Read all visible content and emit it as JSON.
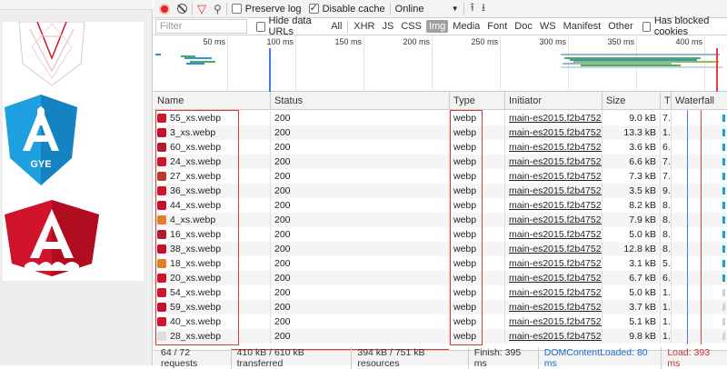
{
  "toolbar": {
    "record_icon": "record-icon",
    "clear_icon": "clear-icon",
    "filter_icon": "filter-icon",
    "search_icon": "search-icon",
    "preserve_log_label": "Preserve log",
    "preserve_log_checked": false,
    "disable_cache_label": "Disable cache",
    "disable_cache_checked": true,
    "throttle_value": "Online",
    "import_icon": "upload-icon",
    "export_icon": "download-icon"
  },
  "filterbar": {
    "placeholder": "Filter",
    "hide_data_urls_label": "Hide data URLs",
    "types": [
      "All",
      "XHR",
      "JS",
      "CSS",
      "Img",
      "Media",
      "Font",
      "Doc",
      "WS",
      "Manifest",
      "Other"
    ],
    "active_type": "Img",
    "blocked_cookies_label": "Has blocked cookies"
  },
  "overview": {
    "ticks": [
      "50 ms",
      "100 ms",
      "150 ms",
      "200 ms",
      "250 ms",
      "300 ms",
      "350 ms",
      "400 ms"
    ]
  },
  "table": {
    "headers": {
      "name": "Name",
      "status": "Status",
      "type": "Type",
      "initiator": "Initiator",
      "size": "Size",
      "time": "T",
      "waterfall": "Waterfall"
    },
    "rows": [
      {
        "name": "55_xs.webp",
        "status": "200",
        "type": "webp",
        "initiator": "main-es2015.f2b4752...",
        "size": "9.0 kB",
        "time": "7."
      },
      {
        "name": "3_xs.webp",
        "status": "200",
        "type": "webp",
        "initiator": "main-es2015.f2b4752...",
        "size": "13.3 kB",
        "time": "1."
      },
      {
        "name": "60_xs.webp",
        "status": "200",
        "type": "webp",
        "initiator": "main-es2015.f2b4752...",
        "size": "3.6 kB",
        "time": "6."
      },
      {
        "name": "24_xs.webp",
        "status": "200",
        "type": "webp",
        "initiator": "main-es2015.f2b4752...",
        "size": "6.6 kB",
        "time": "7."
      },
      {
        "name": "27_xs.webp",
        "status": "200",
        "type": "webp",
        "initiator": "main-es2015.f2b4752...",
        "size": "7.3 kB",
        "time": "7."
      },
      {
        "name": "36_xs.webp",
        "status": "200",
        "type": "webp",
        "initiator": "main-es2015.f2b4752...",
        "size": "3.5 kB",
        "time": "9."
      },
      {
        "name": "44_xs.webp",
        "status": "200",
        "type": "webp",
        "initiator": "main-es2015.f2b4752...",
        "size": "8.2 kB",
        "time": "8."
      },
      {
        "name": "4_xs.webp",
        "status": "200",
        "type": "webp",
        "initiator": "main-es2015.f2b4752...",
        "size": "7.9 kB",
        "time": "8."
      },
      {
        "name": "16_xs.webp",
        "status": "200",
        "type": "webp",
        "initiator": "main-es2015.f2b4752...",
        "size": "5.0 kB",
        "time": "8."
      },
      {
        "name": "38_xs.webp",
        "status": "200",
        "type": "webp",
        "initiator": "main-es2015.f2b4752...",
        "size": "12.8 kB",
        "time": "8."
      },
      {
        "name": "18_xs.webp",
        "status": "200",
        "type": "webp",
        "initiator": "main-es2015.f2b4752...",
        "size": "3.1 kB",
        "time": "5."
      },
      {
        "name": "20_xs.webp",
        "status": "200",
        "type": "webp",
        "initiator": "main-es2015.f2b4752...",
        "size": "6.7 kB",
        "time": "6."
      },
      {
        "name": "54_xs.webp",
        "status": "200",
        "type": "webp",
        "initiator": "main-es2015.f2b4752...",
        "size": "5.0 kB",
        "time": "1."
      },
      {
        "name": "59_xs.webp",
        "status": "200",
        "type": "webp",
        "initiator": "main-es2015.f2b4752...",
        "size": "3.7 kB",
        "time": "1."
      },
      {
        "name": "40_xs.webp",
        "status": "200",
        "type": "webp",
        "initiator": "main-es2015.f2b4752...",
        "size": "5.1 kB",
        "time": "1."
      },
      {
        "name": "28_xs.webp",
        "status": "200",
        "type": "webp",
        "initiator": "main-es2015.f2b4752...",
        "size": "9.8 kB",
        "time": "1."
      }
    ]
  },
  "statusbar": {
    "requests": "64 / 72 requests",
    "transferred": "410 kB / 610 kB transferred",
    "resources": "394 kB / 751 kB resources",
    "finish": "Finish: 395 ms",
    "dom_content_loaded": "DOMContentLoaded: 80 ms",
    "load": "Load: 393 ms"
  },
  "preview": {
    "logo_text": "GYE"
  },
  "colors": {
    "angular_red": "#d0142b",
    "angular_blue": "#1e9fe0",
    "highlight_red": "#d83a3a",
    "record_red": "#e52521",
    "dcl_blue": "#1a6fd6",
    "load_red": "#c33333"
  }
}
